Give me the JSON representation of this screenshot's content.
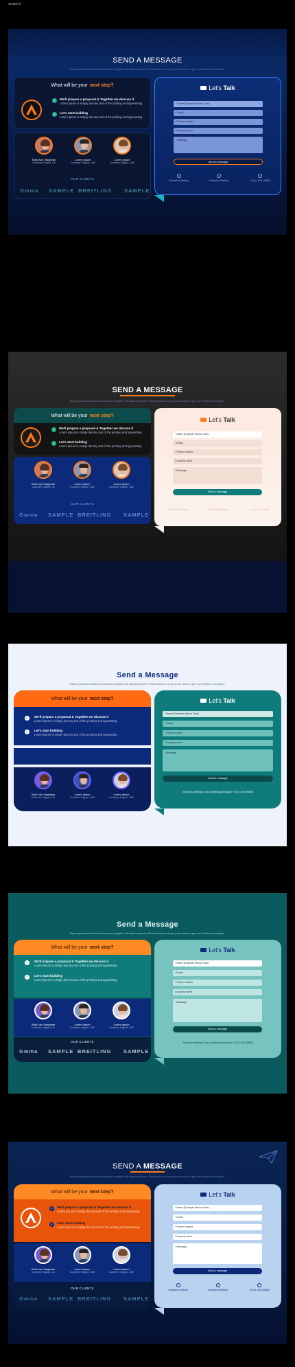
{
  "page_tag": "section-2",
  "common": {
    "subtitle": "Mauris gravida tincidunt scelerisque sagittis velit aliquam ipsum. Pharetra lacus neque porta auctor eget orci eleifend volutpat in.",
    "question_prefix": "What will be your",
    "question_highlight": "next step?",
    "step1_title": "We'll prepare a proposal & Together we discuss it",
    "step1_text": "Lorem ipsum is simply dummy text of the printing and typesetting",
    "step2_title": "Let's start building",
    "step2_text": "Lorem ipsum is simply dummy text of the printing and typesetting",
    "people": [
      {
        "name": "Ruth Ann Varghese",
        "role": "Customer Support, UK"
      },
      {
        "name": "Lorem ipsum",
        "role": "Customer Support, UAE"
      },
      {
        "name": "Lorem ipsum",
        "role": "Customer Support, UAE"
      }
    ],
    "clients_label": "OUR CLIENTS",
    "brands": [
      "Gmma",
      "SAMPLE",
      "BREITLING",
      "SAMPLE"
    ],
    "form_title_prefix": "Let's",
    "form_title_bold": "Talk",
    "fields": [
      "* Name (Example Mouse Over)",
      "* Email",
      "* Phone number",
      "Company name",
      "* Message"
    ],
    "send_label": "Send a message",
    "footer": [
      "Schedule a Meeting",
      "Schedule a Meeting",
      "+44 (0) 1234 456680"
    ],
    "footer_line": "Schedule a Meeting | Send a WhatsApp Message | +44 (0) 1234 456680"
  },
  "sections": [
    {
      "title_a": "SEND A",
      "title_b": "MESSAGE"
    },
    {
      "title_a": "SEND A",
      "title_b": "MESSAGE"
    },
    {
      "title_a": "Send a",
      "title_b": "Message"
    },
    {
      "title_a": "Send a",
      "title_b": "Message"
    },
    {
      "title_a": "SEND A",
      "title_b": "MESSAGE"
    }
  ],
  "colors": {
    "accent": "#ff7a1a",
    "navy": "#0c2a7a",
    "teal": "#0f7c7b",
    "light_blue": "#b9d2ef"
  }
}
